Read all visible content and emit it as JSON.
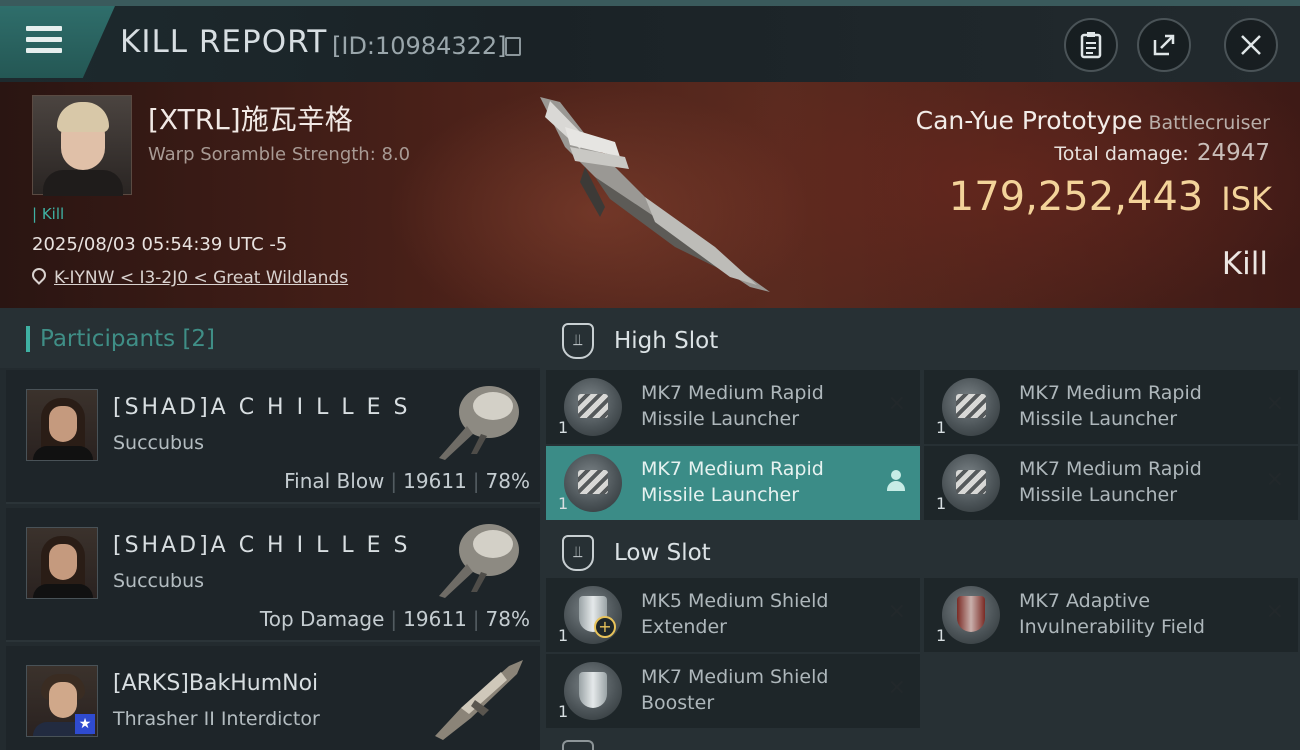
{
  "header": {
    "title": "KILL REPORT",
    "report_id": "[ID:10984322]",
    "buttons": [
      "clipboard-icon",
      "share-icon",
      "close-icon"
    ]
  },
  "victim": {
    "name": "[XTRL]施瓦辛格",
    "scramble": "Warp Soramble Strength: 8.0",
    "tag": "Kill",
    "datetime": "2025/08/03 05:54:39 UTC -5",
    "location": "K-IYNW < I3-2J0 < Great Wildlands",
    "ship_name": "Can-Yue Prototype",
    "ship_class": "Battlecruiser",
    "damage_label": "Total damage:",
    "damage_value": "24947",
    "isk_value": "179,252,443",
    "isk_unit": "ISK",
    "result": "Kill"
  },
  "participants": {
    "title": "Participants",
    "count": "[2]",
    "rows": [
      {
        "name": "[SHAD]A C H I L L E S",
        "ship": "Succubus",
        "role": "Final Blow",
        "damage": "19611",
        "percent": "78%"
      },
      {
        "name": "[SHAD]A C H I L L E S",
        "ship": "Succubus",
        "role": "Top Damage",
        "damage": "19611",
        "percent": "78%"
      },
      {
        "name": "[ARKS]BakHumNoi",
        "ship": "Thrasher II Interdictor",
        "role": "",
        "damage": "",
        "percent": ""
      }
    ]
  },
  "slots": {
    "high": {
      "title": "High Slot",
      "modules": [
        {
          "name": "MK7 Medium Rapid Missile Launcher",
          "qty": "1"
        },
        {
          "name": "MK7 Medium Rapid Missile Launcher",
          "qty": "1"
        },
        {
          "name": "MK7 Medium Rapid Missile Launcher",
          "qty": "1"
        },
        {
          "name": "MK7 Medium Rapid Missile Launcher",
          "qty": "1"
        }
      ]
    },
    "low": {
      "title": "Low Slot",
      "modules": [
        {
          "name": "MK5 Medium Shield Extender",
          "qty": "1"
        },
        {
          "name": "MK7 Adaptive Invulnerability Field",
          "qty": "1"
        },
        {
          "name": "MK7 Medium Shield Booster",
          "qty": "1"
        }
      ]
    }
  },
  "colors": {
    "accent": "#3fb1a3",
    "isk": "#f3d39a",
    "active_row": "#3b8c87"
  }
}
